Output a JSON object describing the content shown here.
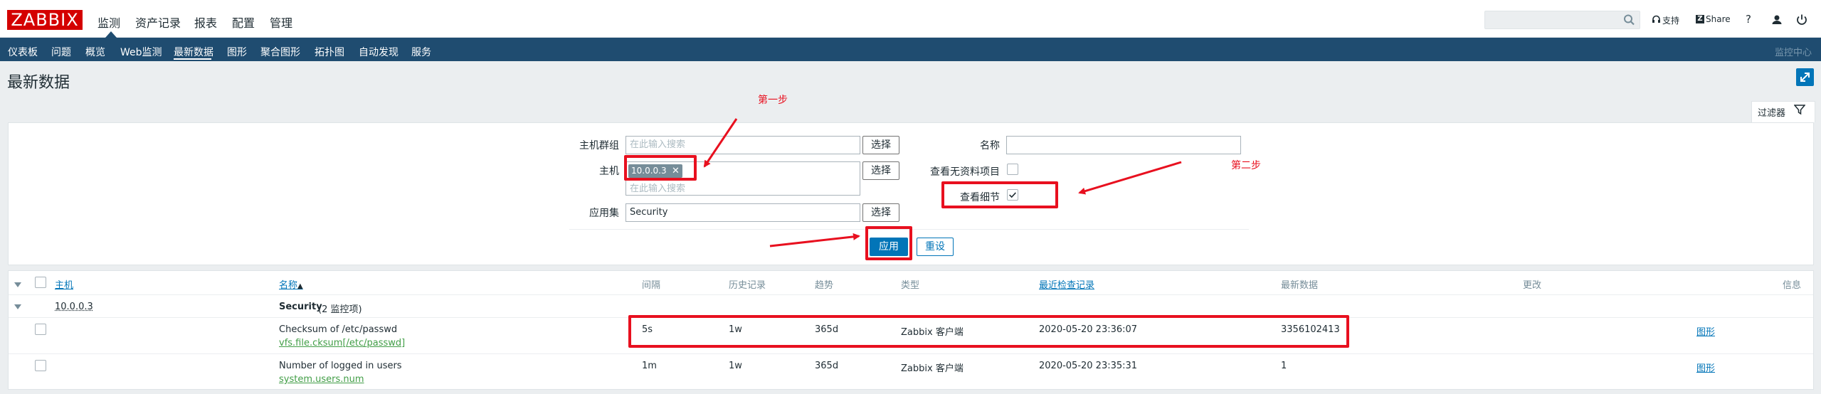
{
  "header": {
    "logo": "ZABBIX",
    "nav": [
      "监测",
      "资产记录",
      "报表",
      "配置",
      "管理"
    ],
    "search_placeholder": "",
    "support": "支持",
    "share": "Share",
    "help": "?"
  },
  "subnav": {
    "items": [
      "仪表板",
      "问题",
      "概览",
      "Web监测",
      "最新数据",
      "图形",
      "聚合图形",
      "拓扑图",
      "自动发现",
      "服务"
    ],
    "active": "最新数据",
    "right": "监控中心"
  },
  "page": {
    "title": "最新数据"
  },
  "filter": {
    "tab_label": "过滤器",
    "host_group_label": "主机群组",
    "host_group_placeholder": "在此输入搜索",
    "host_label": "主机",
    "host_chip": "10.0.0.3",
    "host_placeholder": "在此输入搜索",
    "app_label": "应用集",
    "app_value": "Security",
    "select_button": "选择",
    "name_label": "名称",
    "name_value": "",
    "show_no_data_label": "查看无资料项目",
    "show_details_label": "查看细节",
    "show_no_data_checked": false,
    "show_details_checked": true,
    "apply": "应用",
    "reset": "重设"
  },
  "annotations": {
    "step1": "第一步",
    "step2": "第二步"
  },
  "table": {
    "columns": {
      "host": "主机",
      "name": "名称",
      "sort_indicator": "▲",
      "interval": "间隔",
      "history": "历史记录",
      "trends": "趋势",
      "type": "类型",
      "lastcheck": "最近检查记录",
      "lastvalue": "最新数据",
      "change": "更改",
      "info": "信息"
    },
    "group": {
      "host": "10.0.0.3",
      "app": "Security",
      "count": "(2 监控项)"
    },
    "rows": [
      {
        "name": "Checksum of /etc/passwd",
        "key": "vfs.file.cksum[/etc/passwd]",
        "interval": "5s",
        "history": "1w",
        "trends": "365d",
        "type": "Zabbix 客户端",
        "lastcheck": "2020-05-20 23:36:07",
        "lastvalue": "3356102413",
        "change": "",
        "link": "图形"
      },
      {
        "name": "Number of logged in users",
        "key": "system.users.num",
        "interval": "1m",
        "history": "1w",
        "trends": "365d",
        "type": "Zabbix 客户端",
        "lastcheck": "2020-05-20 23:35:31",
        "lastvalue": "1",
        "change": "",
        "link": "图形"
      }
    ]
  },
  "colors": {
    "accent": "#0275b8",
    "nav_bg": "#1f4c70",
    "logo": "#d40000",
    "annotation": "#e8101f",
    "item_key": "#429e47"
  }
}
